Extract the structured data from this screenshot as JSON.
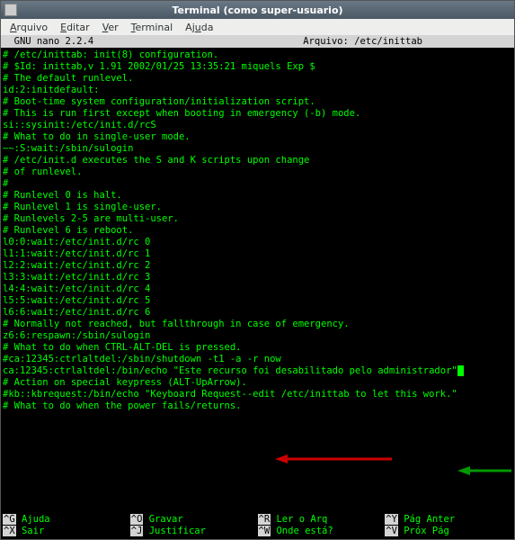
{
  "window": {
    "title": "Terminal (como super-usuario)"
  },
  "menubar": {
    "items": [
      {
        "accel": "A",
        "rest": "rquivo"
      },
      {
        "accel": "E",
        "rest": "ditar"
      },
      {
        "accel": "V",
        "rest": "er"
      },
      {
        "accel": "T",
        "rest": "erminal"
      },
      {
        "accel": "",
        "rest": "Aj",
        "accel2": "u",
        "rest2": "da"
      }
    ]
  },
  "nano": {
    "version": "  GNU nano 2.2.4",
    "file_label": "Arquivo: /etc/inittab"
  },
  "file_lines": [
    "# /etc/inittab: init(8) configuration.",
    "# $Id: inittab,v 1.91 2002/01/25 13:35:21 miquels Exp $",
    "",
    "# The default runlevel.",
    "id:2:initdefault:",
    "",
    "# Boot-time system configuration/initialization script.",
    "# This is run first except when booting in emergency (-b) mode.",
    "si::sysinit:/etc/init.d/rcS",
    "",
    "# What to do in single-user mode.",
    "~~:S:wait:/sbin/sulogin",
    "",
    "# /etc/init.d executes the S and K scripts upon change",
    "# of runlevel.",
    "#",
    "# Runlevel 0 is halt.",
    "# Runlevel 1 is single-user.",
    "# Runlevels 2-5 are multi-user.",
    "# Runlevel 6 is reboot.",
    "",
    "l0:0:wait:/etc/init.d/rc 0",
    "l1:1:wait:/etc/init.d/rc 1",
    "l2:2:wait:/etc/init.d/rc 2",
    "l3:3:wait:/etc/init.d/rc 3",
    "l4:4:wait:/etc/init.d/rc 4",
    "l5:5:wait:/etc/init.d/rc 5",
    "l6:6:wait:/etc/init.d/rc 6",
    "# Normally not reached, but fallthrough in case of emergency.",
    "z6:6:respawn:/sbin/sulogin",
    "",
    "# What to do when CTRL-ALT-DEL is pressed.",
    "#ca:12345:ctrlaltdel:/sbin/shutdown -t1 -a -r now",
    "ca:12345:ctrlaltdel:/bin/echo \"Este recurso foi desabilitado pelo administrador\"",
    "",
    "# Action on special keypress (ALT-UpArrow).",
    "#kb::kbrequest:/bin/echo \"Keyboard Request--edit /etc/inittab to let this work.\"",
    "",
    "# What to do when the power fails/returns."
  ],
  "cursor_line_index": 33,
  "footer": {
    "row1": [
      {
        "key": "^G",
        "label": " Ajuda"
      },
      {
        "key": "^O",
        "label": " Gravar"
      },
      {
        "key": "^R",
        "label": " Ler o Arq"
      },
      {
        "key": "^Y",
        "label": " Pág Anter"
      }
    ],
    "row2": [
      {
        "key": "^X",
        "label": " Sair"
      },
      {
        "key": "^J",
        "label": " Justificar"
      },
      {
        "key": "^W",
        "label": " Onde está?"
      },
      {
        "key": "^V",
        "label": " Próx Pág"
      }
    ]
  },
  "colors": {
    "terminal_fg": "#00ff00",
    "terminal_bg": "#000000",
    "arrow_red": "#cc0000",
    "arrow_green": "#009900"
  }
}
